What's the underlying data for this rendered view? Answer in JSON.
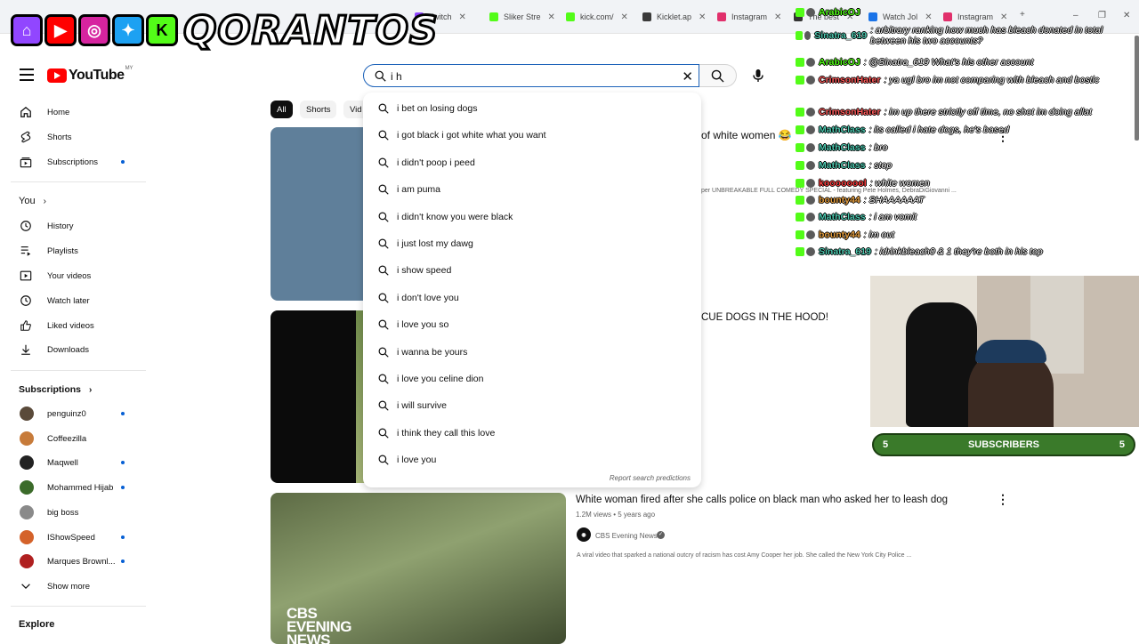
{
  "browser": {
    "tabs": [
      {
        "label": "Twitch",
        "color": "#9146ff"
      },
      {
        "label": "Sliker Stre",
        "color": "#53fc18"
      },
      {
        "label": "kick.com/",
        "color": "#53fc18"
      },
      {
        "label": "Kicklet.ap",
        "color": "#3a3a3a"
      },
      {
        "label": "Instagram",
        "color": "#e1306c"
      },
      {
        "label": "The best",
        "color": "#333"
      },
      {
        "label": "Watch Jol",
        "color": "#1a73e8"
      },
      {
        "label": "Instagram",
        "color": "#e1306c"
      }
    ],
    "new_tab": "+",
    "window_controls": [
      "–",
      "❐",
      "✕"
    ]
  },
  "overlay": {
    "brand": "QORANTOS",
    "icons": [
      "twitch-icon",
      "youtube-icon",
      "instagram-icon",
      "twitter-icon",
      "kick-icon"
    ]
  },
  "youtube": {
    "logo_text": "YouTube",
    "region": "MY",
    "search": {
      "value": "i h",
      "placeholder": "Search"
    },
    "suggestions": [
      "i bet on losing dogs",
      "i got black i got white what you want",
      "i didn't poop i peed",
      "i am puma",
      "i didn't know you were black",
      "i just lost my dawg",
      "i show speed",
      "i don't love you",
      "i love you so",
      "i wanna be yours",
      "i love you celine dion",
      "i will survive",
      "i think they call this love",
      "i love you"
    ],
    "report_label": "Report search predictions",
    "chips": [
      "All",
      "Shorts",
      "Vid"
    ],
    "sidebar": {
      "main": [
        "Home",
        "Shorts",
        "Subscriptions"
      ],
      "you_label": "You",
      "you_items": [
        "History",
        "Playlists",
        "Your videos",
        "Watch later",
        "Liked videos",
        "Downloads"
      ],
      "subs_label": "Subscriptions",
      "subs": [
        {
          "name": "penguinz0",
          "color": "#5a4a3a",
          "dot": true
        },
        {
          "name": "Coffeezilla",
          "color": "#c77b3a",
          "dot": false
        },
        {
          "name": "Maqwell",
          "color": "#222222",
          "dot": true
        },
        {
          "name": "Mohammed Hijab",
          "color": "#3b6b2a",
          "dot": true
        },
        {
          "name": "big boss",
          "color": "#8a8a8a",
          "dot": false
        },
        {
          "name": "IShowSpeed",
          "color": "#d4622a",
          "dot": true
        },
        {
          "name": "Marques Brownl...",
          "color": "#b02020",
          "dot": true
        }
      ],
      "show_more": "Show more",
      "explore": "Explore"
    },
    "videos": [
      {
        "title_partial": "of white women 😂",
        "desc_partial": "per UNBREAKABLE FULL COMEDY SPECIAL - featuring Pete Holmes, DebraDiGiovanni ..."
      },
      {
        "title_partial": "CUE DOGS IN THE HOOD!"
      },
      {
        "title": "White woman fired after she calls police on black man who asked her to leash dog",
        "meta": "1.2M views • 5 years ago",
        "channel": "CBS Evening News",
        "desc": "A viral video that sparked a national outcry of racism has cost Amy Cooper her job. She called the New York City Police ...",
        "thumb_text": "CBS EVENING NEWS"
      }
    ]
  },
  "chat": [
    {
      "user": "ArabicOJ",
      "color": "#53fc18",
      "msg": ""
    },
    {
      "user": "Sinatra_619",
      "color": "#4ec9b0",
      "msg": ": arbitrary ranking how much has bleach donated in total between his two accounts?"
    },
    {
      "user": "ArabicOJ",
      "color": "#53fc18",
      "msg": ": @Sinatra_619 What's his other account"
    },
    {
      "user": "CrimsonHater",
      "color": "#ff5b5b",
      "msg": ": ya ugl bro im not comparing with bleach and bostic"
    },
    {
      "user": "CrimsonHater",
      "color": "#ff5b5b",
      "msg": ": im up there strictly off time, no shot im doing allat"
    },
    {
      "user": "MathClass",
      "color": "#4ec9b0",
      "msg": ": its called i hate dogs, he's based"
    },
    {
      "user": "MathClass",
      "color": "#4ec9b0",
      "msg": ": bro"
    },
    {
      "user": "MathClass",
      "color": "#4ec9b0",
      "msg": ": stop"
    },
    {
      "user": "koooooool",
      "color": "#ff4040",
      "msg": ": white women"
    },
    {
      "user": "bounty44",
      "color": "#e8a040",
      "msg": ": SHAAAAAAT"
    },
    {
      "user": "MathClass",
      "color": "#4ec9b0",
      "msg": ": i am vomit"
    },
    {
      "user": "bounty44",
      "color": "#e8a040",
      "msg": ": im out"
    },
    {
      "user": "Sinatra_619",
      "color": "#4ec9b0",
      "msg": ": idrinkbleach0 & 1 they're both in his top"
    }
  ],
  "subscribers_bar": {
    "left": "5",
    "label": "SUBSCRIBERS",
    "right": "5"
  }
}
